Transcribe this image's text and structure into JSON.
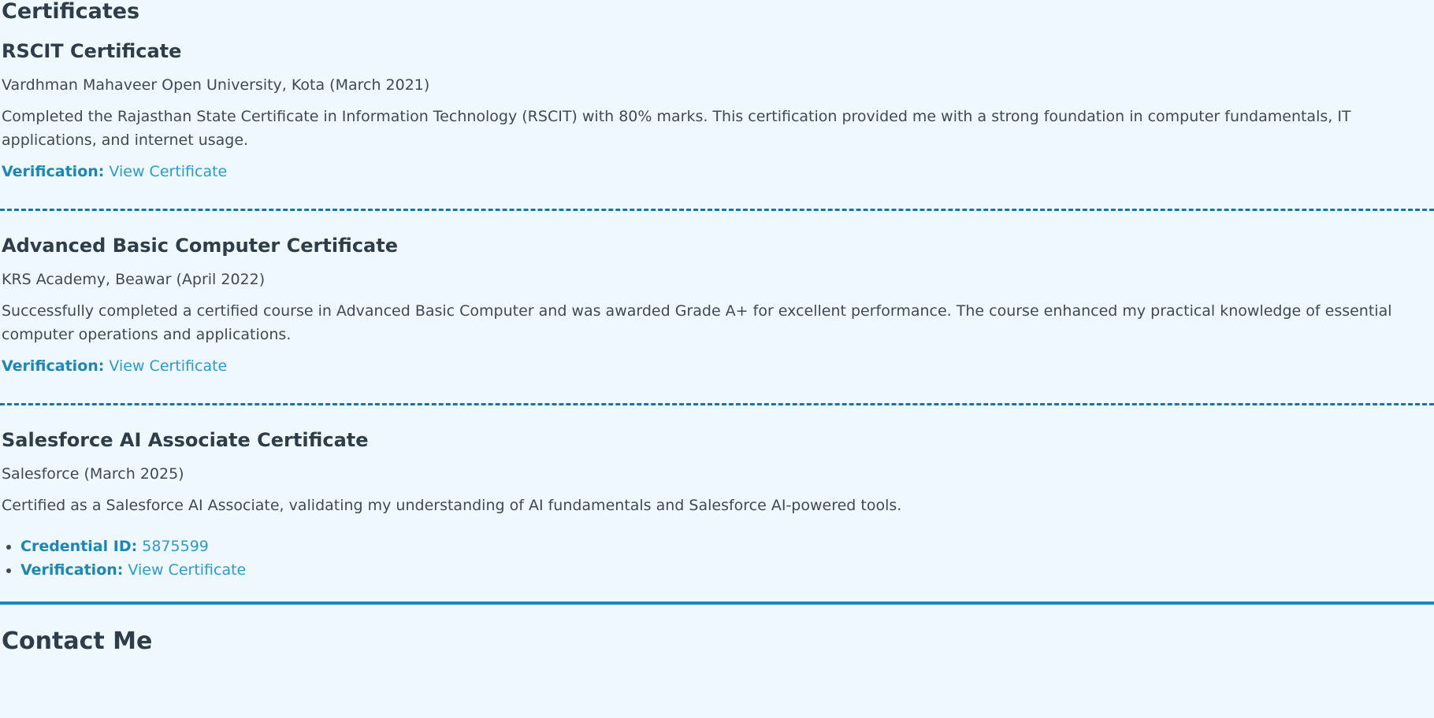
{
  "certificates_section": {
    "title": "Certificates"
  },
  "certificates": [
    {
      "title": "RSCIT Certificate",
      "org": "Vardhman Mahaveer Open University, Kota (March 2021)",
      "description": "Completed the Rajasthan State Certificate in Information Technology (RSCIT) with 80% marks. This certification provided me with a strong foundation in computer fundamentals, IT applications, and internet usage.",
      "verification_label": "Verification:",
      "verification_link": "View Certificate"
    },
    {
      "title": "Advanced Basic Computer Certificate",
      "org": "KRS Academy, Beawar (April 2022)",
      "description": "Successfully completed a certified course in Advanced Basic Computer and was awarded Grade A+ for excellent performance. The course enhanced my practical knowledge of essential computer operations and applications.",
      "verification_label": "Verification:",
      "verification_link": "View Certificate"
    },
    {
      "title": "Salesforce AI Associate Certificate",
      "org": "Salesforce (March 2025)",
      "description": "Certified as a Salesforce AI Associate, validating my understanding of AI fundamentals and Salesforce AI-powered tools.",
      "credential_label": "Credential ID:",
      "credential_value": "5875599",
      "verification_label": "Verification:",
      "verification_link": "View Certificate"
    }
  ],
  "contact_section": {
    "title": "Contact Me"
  },
  "colors": {
    "background": "#eff8fe",
    "heading": "#2f3d4b",
    "body_text": "#3d4a55",
    "label_accent": "#1c86b5",
    "link": "#2a9bce",
    "divider": "#1776a5"
  }
}
